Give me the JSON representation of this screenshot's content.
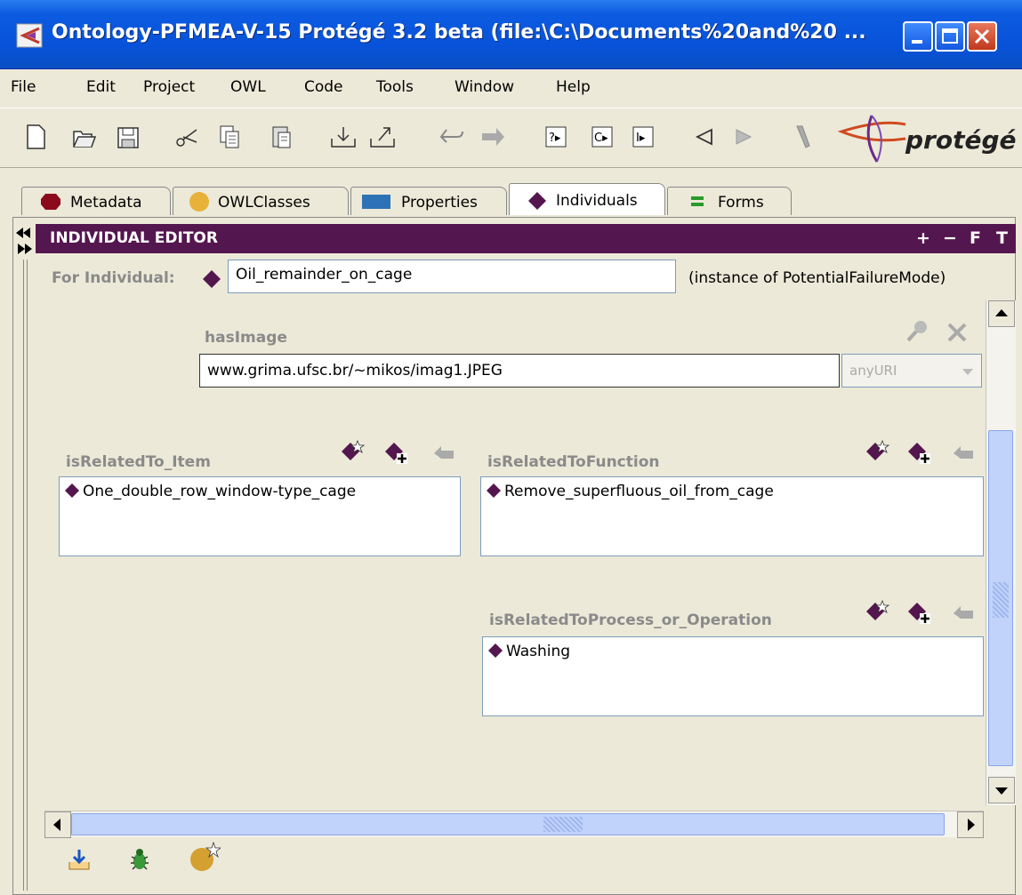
{
  "window": {
    "title": "Ontology-PFMEA-V-15  Protégé 3.2 beta    (file:\\C:\\Documents%20and%20 ...",
    "buttons": [
      "minimize",
      "maximize",
      "close"
    ]
  },
  "menu": [
    "File",
    "Edit",
    "Project",
    "OWL",
    "Code",
    "Tools",
    "Window",
    "Help"
  ],
  "toolbar": {
    "icons": [
      "new-icon",
      "open-icon",
      "save-icon",
      "cut-icon",
      "copy-icon",
      "paste-icon",
      "import-icon",
      "export-icon",
      "undo-icon",
      "redo-icon",
      "query-icon",
      "class-icon",
      "instance-icon",
      "back-icon",
      "forward-icon",
      "pen-icon"
    ],
    "logo": "protégé"
  },
  "tabs": [
    {
      "label": "Metadata",
      "color": "#8b0b1c"
    },
    {
      "label": "OWLClasses",
      "color": "#e8b23a"
    },
    {
      "label": "Properties",
      "color": "#2d72b5"
    },
    {
      "label": "Individuals",
      "color": "#54164f",
      "active": true
    },
    {
      "label": "Forms",
      "color": "#2a9a2a"
    }
  ],
  "editor": {
    "title": "INDIVIDUAL EDITOR",
    "header_buttons": [
      "+",
      "−",
      "F",
      "T"
    ],
    "for_individual_label": "For Individual:",
    "individual_name": "Oil_remainder_on_cage",
    "instance_of": "(instance of PotentialFailureMode)",
    "hasImage": {
      "label": "hasImage",
      "value": "www.grima.ufsc.br/~mikos/imag1.JPEG",
      "type": "anyURI"
    },
    "isRelatedTo_Item": {
      "label": "isRelatedTo_Item",
      "values": [
        "One_double_row_window-type_cage"
      ]
    },
    "isRelatedToFunction": {
      "label": "isRelatedToFunction",
      "values": [
        "Remove_superfluous_oil_from_cage"
      ]
    },
    "isRelatedToProcess_or_Operation": {
      "label": "isRelatedToProcess_or_Operation",
      "values": [
        "Washing"
      ]
    }
  },
  "colors": {
    "titlebar": "#0752d8",
    "editor_header": "#54164f",
    "individual_diamond": "#54164f"
  }
}
